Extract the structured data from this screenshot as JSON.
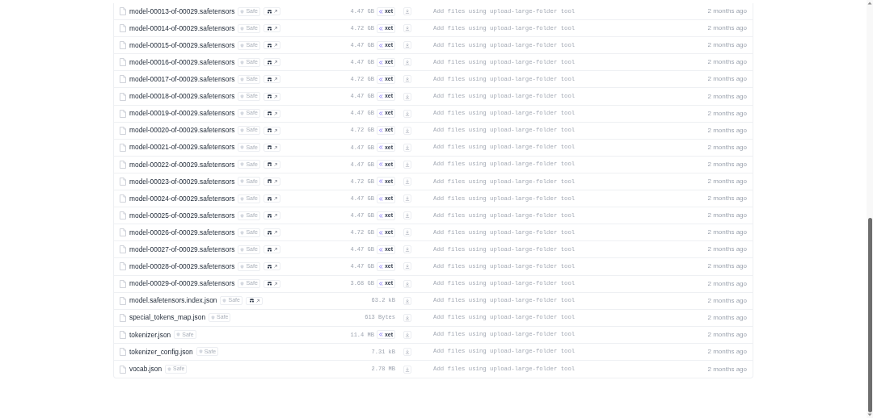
{
  "files": [
    {
      "name": "model-00013-of-00029.safetensors",
      "safe": "Safe",
      "scan": true,
      "size": "4.47 GB",
      "xet": "xet",
      "commit": "Add files using upload-large-folder tool",
      "date": "2 months ago"
    },
    {
      "name": "model-00014-of-00029.safetensors",
      "safe": "Safe",
      "scan": true,
      "size": "4.72 GB",
      "xet": "xet",
      "commit": "Add files using upload-large-folder tool",
      "date": "2 months ago"
    },
    {
      "name": "model-00015-of-00029.safetensors",
      "safe": "Safe",
      "scan": true,
      "size": "4.47 GB",
      "xet": "xet",
      "commit": "Add files using upload-large-folder tool",
      "date": "2 months ago"
    },
    {
      "name": "model-00016-of-00029.safetensors",
      "safe": "Safe",
      "scan": true,
      "size": "4.47 GB",
      "xet": "xet",
      "commit": "Add files using upload-large-folder tool",
      "date": "2 months ago"
    },
    {
      "name": "model-00017-of-00029.safetensors",
      "safe": "Safe",
      "scan": true,
      "size": "4.72 GB",
      "xet": "xet",
      "commit": "Add files using upload-large-folder tool",
      "date": "2 months ago"
    },
    {
      "name": "model-00018-of-00029.safetensors",
      "safe": "Safe",
      "scan": true,
      "size": "4.47 GB",
      "xet": "xet",
      "commit": "Add files using upload-large-folder tool",
      "date": "2 months ago"
    },
    {
      "name": "model-00019-of-00029.safetensors",
      "safe": "Safe",
      "scan": true,
      "size": "4.47 GB",
      "xet": "xet",
      "commit": "Add files using upload-large-folder tool",
      "date": "2 months ago"
    },
    {
      "name": "model-00020-of-00029.safetensors",
      "safe": "Safe",
      "scan": true,
      "size": "4.72 GB",
      "xet": "xet",
      "commit": "Add files using upload-large-folder tool",
      "date": "2 months ago"
    },
    {
      "name": "model-00021-of-00029.safetensors",
      "safe": "Safe",
      "scan": true,
      "size": "4.47 GB",
      "xet": "xet",
      "commit": "Add files using upload-large-folder tool",
      "date": "2 months ago"
    },
    {
      "name": "model-00022-of-00029.safetensors",
      "safe": "Safe",
      "scan": true,
      "size": "4.47 GB",
      "xet": "xet",
      "commit": "Add files using upload-large-folder tool",
      "date": "2 months ago"
    },
    {
      "name": "model-00023-of-00029.safetensors",
      "safe": "Safe",
      "scan": true,
      "size": "4.72 GB",
      "xet": "xet",
      "commit": "Add files using upload-large-folder tool",
      "date": "2 months ago"
    },
    {
      "name": "model-00024-of-00029.safetensors",
      "safe": "Safe",
      "scan": true,
      "size": "4.47 GB",
      "xet": "xet",
      "commit": "Add files using upload-large-folder tool",
      "date": "2 months ago"
    },
    {
      "name": "model-00025-of-00029.safetensors",
      "safe": "Safe",
      "scan": true,
      "size": "4.47 GB",
      "xet": "xet",
      "commit": "Add files using upload-large-folder tool",
      "date": "2 months ago"
    },
    {
      "name": "model-00026-of-00029.safetensors",
      "safe": "Safe",
      "scan": true,
      "size": "4.72 GB",
      "xet": "xet",
      "commit": "Add files using upload-large-folder tool",
      "date": "2 months ago"
    },
    {
      "name": "model-00027-of-00029.safetensors",
      "safe": "Safe",
      "scan": true,
      "size": "4.47 GB",
      "xet": "xet",
      "commit": "Add files using upload-large-folder tool",
      "date": "2 months ago"
    },
    {
      "name": "model-00028-of-00029.safetensors",
      "safe": "Safe",
      "scan": true,
      "size": "4.47 GB",
      "xet": "xet",
      "commit": "Add files using upload-large-folder tool",
      "date": "2 months ago"
    },
    {
      "name": "model-00029-of-00029.safetensors",
      "safe": "Safe",
      "scan": true,
      "size": "3.68 GB",
      "xet": "xet",
      "commit": "Add files using upload-large-folder tool",
      "date": "2 months ago"
    },
    {
      "name": "model.safetensors.index.json",
      "safe": "Safe",
      "scan": true,
      "size": "63.2 kB",
      "commit": "Add files using upload-large-folder tool",
      "date": "2 months ago"
    },
    {
      "name": "special_tokens_map.json",
      "safe": "Safe",
      "scan": false,
      "size": "613 Bytes",
      "commit": "Add files using upload-large-folder tool",
      "date": "2 months ago"
    },
    {
      "name": "tokenizer.json",
      "safe": "Safe",
      "scan": false,
      "size": "11.4 MB",
      "xet": "xet",
      "commit": "Add files using upload-large-folder tool",
      "date": "2 months ago"
    },
    {
      "name": "tokenizer_config.json",
      "safe": "Safe",
      "scan": false,
      "size": "7.31 kB",
      "commit": "Add files using upload-large-folder tool",
      "date": "2 months ago"
    },
    {
      "name": "vocab.json",
      "safe": "Safe",
      "scan": false,
      "size": "2.78 MB",
      "commit": "Add files using upload-large-folder tool",
      "date": "2 months ago"
    }
  ]
}
